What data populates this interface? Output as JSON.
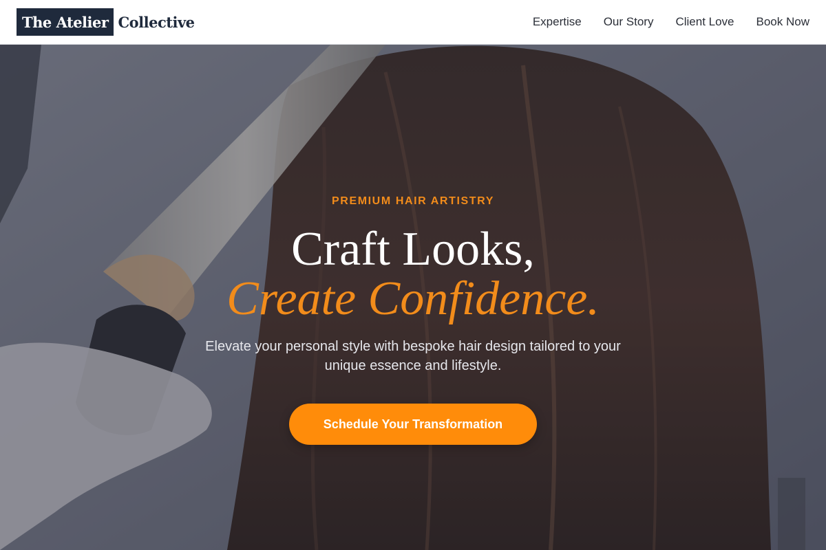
{
  "brand": {
    "name_boxed": "The Atelier",
    "name_plain": "Collective"
  },
  "nav": {
    "items": [
      {
        "label": "Expertise"
      },
      {
        "label": "Our Story"
      },
      {
        "label": "Client Love"
      },
      {
        "label": "Book Now"
      }
    ]
  },
  "hero": {
    "eyebrow": "PREMIUM HAIR ARTISTRY",
    "headline_line1": "Craft Looks,",
    "headline_line2": "Create Confidence.",
    "subtext": "Elevate your personal style with bespoke hair design tailored to your unique essence and lifestyle.",
    "cta_label": "Schedule Your Transformation",
    "background": "photo: stylist curling woman's long brown hair with a curling iron"
  },
  "colors": {
    "accent": "#ff8c0a",
    "brand_dark": "#1f2a3c",
    "nav_text": "#2b2f38"
  }
}
